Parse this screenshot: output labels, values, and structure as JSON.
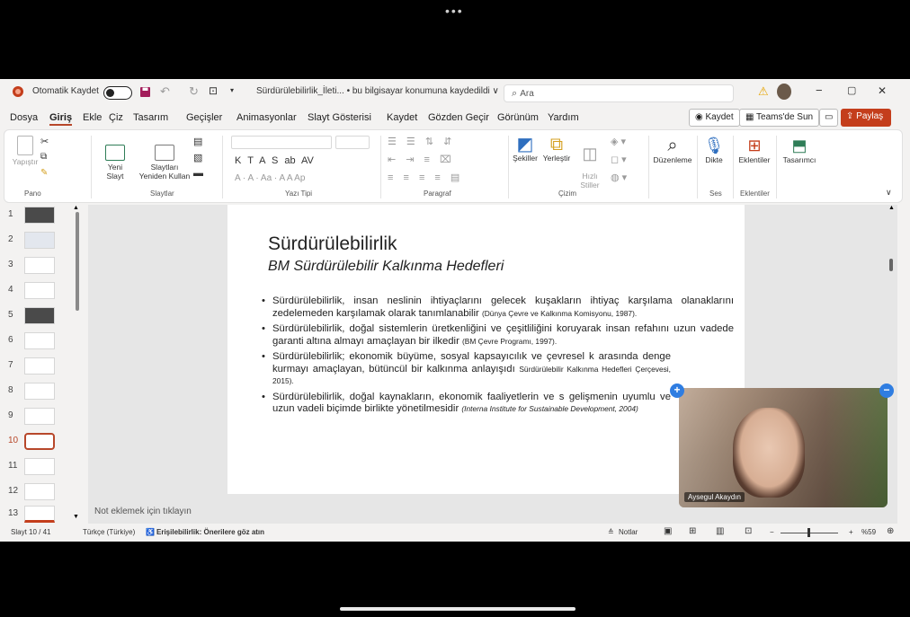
{
  "system": {
    "dots": "•••"
  },
  "titlebar": {
    "autosave_label": "Otomatik Kaydet",
    "filename": "Sürdürülebilirlik_İleti... • bu bilgisayar konumuna kaydedildi ∨",
    "search_placeholder": "Ara",
    "minimize": "−",
    "restore": "▢",
    "close": "✕"
  },
  "menubar": {
    "items": [
      "Dosya",
      "Giriş",
      "Ekle",
      "Çiz",
      "Tasarım",
      "Geçişler",
      "Animasyonlar",
      "Slayt Gösterisi",
      "Kaydet",
      "Gözden Geçir",
      "Görünüm",
      "Yardım"
    ],
    "record_button": "◉ Kaydet",
    "teams_button": "Teams'de Sun",
    "share_button": "Paylaş"
  },
  "ribbon": {
    "paste": "Yapıştır",
    "new_slide": "Yeni\nSlayt",
    "slides_reuse": "Slaytları\nYeniden Kullan",
    "group_pano": "Pano",
    "group_slaytlar": "Slaytlar",
    "group_yazi": "Yazı Tipi",
    "group_paragraf": "Paragraf",
    "group_cizim": "Çizim",
    "group_ses": "Ses",
    "group_eklentiler": "Eklentiler",
    "shapes": "Şekiller",
    "arrange": "Yerleştir",
    "quick_styles": "Hızlı\nStiller",
    "editing": "Düzenleme",
    "dictate": "Dikte",
    "addins": "Eklentiler",
    "designer": "Tasarımcı",
    "font_row": "K  T  A  S  ab  AV",
    "font_row2": "A  ·  A  ·  Aa  ·  A  A  Ap"
  },
  "thumbnails": {
    "numbers": [
      "1",
      "2",
      "3",
      "4",
      "5",
      "6",
      "7",
      "8",
      "9",
      "10",
      "11",
      "12",
      "13"
    ],
    "selected": 10
  },
  "slide": {
    "title": "Sürdürülebilirlik",
    "subtitle": "BM Sürdürülebilir Kalkınma Hedefleri",
    "bullets": [
      {
        "text": "Sürdürülebilirlik, insan neslinin ihtiyaçlarını gelecek kuşakların ihtiyaç karşılama olanaklarını zedelemeden karşılamak olarak tanımlanabilir",
        "source": "(Dünya Çevre ve Kalkınma Komisyonu, 1987)."
      },
      {
        "text": "Sürdürülebilirlik, doğal sistemlerin üretkenliğini ve çeşitliliğini koruyarak insan refahını uzun vadede garanti altına almayı amaçlayan bir ilkedir",
        "source": "(BM Çevre Programı, 1997)."
      },
      {
        "text": "Sürdürülebilirlik; ekonomik büyüme, sosyal kapsayıcılık ve çevresel k arasında denge kurmayı amaçlayan, bütüncül bir kalkınma anlayışıdı",
        "source": "Sürdürülebilir Kalkınma Hedefleri Çerçevesi, 2015)."
      },
      {
        "text": "Sürdürülebilirlik, doğal kaynakların, ekonomik faaliyetlerin ve s gelişmenin uyumlu ve uzun vadeli biçimde birlikte yönetilmesidir",
        "source": "(Interna Institute for Sustainable Development, 2004)"
      }
    ]
  },
  "notes": {
    "placeholder": "Not eklemek için tıklayın"
  },
  "video": {
    "participant": "Aysegul Akaydın",
    "plus": "+",
    "minus": "−"
  },
  "status": {
    "slide_counter": "Slayt 10 / 41",
    "language": "Türkçe (Türkiye)",
    "accessibility": "Erişilebilirlik: Önerilere göz atın",
    "notes_button": "Notlar",
    "zoom": "%59"
  }
}
